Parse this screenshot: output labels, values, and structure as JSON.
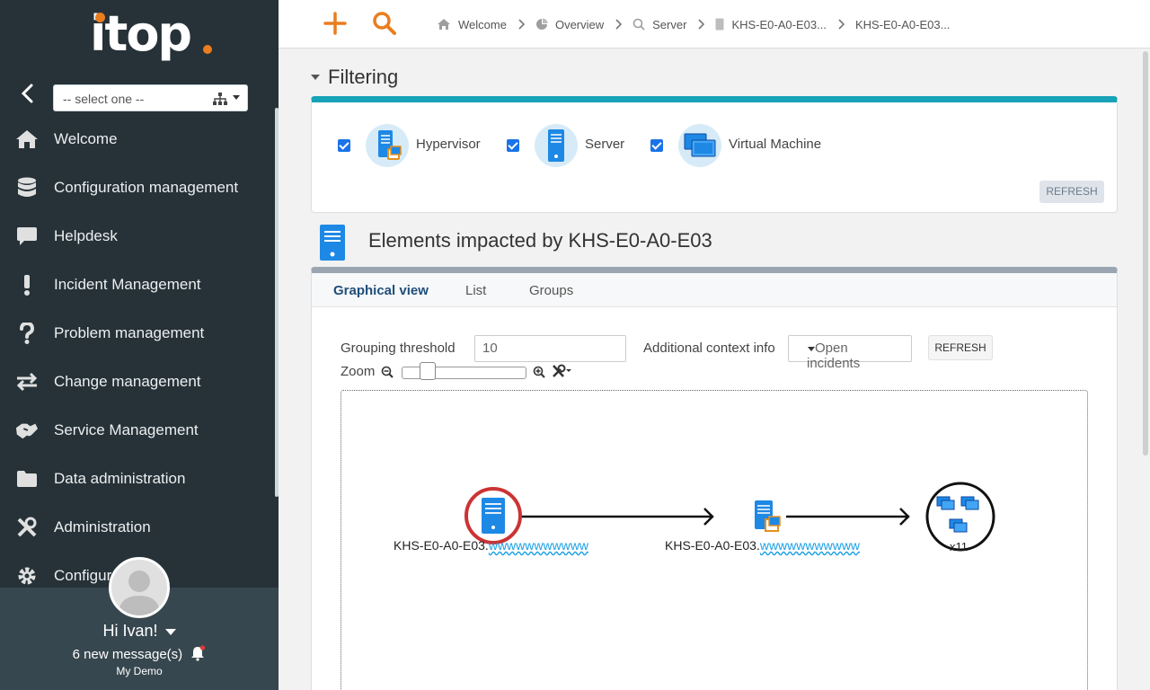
{
  "app": {
    "logo_text": "itop"
  },
  "sidebar": {
    "org_select": {
      "value": "-- select one --"
    },
    "items": [
      {
        "label": "Welcome",
        "icon": "home-icon"
      },
      {
        "label": "Configuration management",
        "icon": "database-icon"
      },
      {
        "label": "Helpdesk",
        "icon": "chat-bubble-icon"
      },
      {
        "label": "Incident Management",
        "icon": "exclamation-icon"
      },
      {
        "label": "Problem management",
        "icon": "question-icon"
      },
      {
        "label": "Change management",
        "icon": "exchange-arrows-icon"
      },
      {
        "label": "Service Management",
        "icon": "handshake-icon"
      },
      {
        "label": "Data administration",
        "icon": "folder-icon"
      },
      {
        "label": "Administration",
        "icon": "tools-icon"
      },
      {
        "label": "Configura",
        "icon": "gear-icon"
      }
    ],
    "user": {
      "greeting": "Hi Ivan!",
      "messages": "6 new message(s)",
      "organization": "My Demo"
    }
  },
  "topbar": {
    "breadcrumb": [
      {
        "label": "Welcome",
        "icon": "home-icon"
      },
      {
        "label": "Overview",
        "icon": "pie-chart-icon"
      },
      {
        "label": "Server",
        "icon": "search-icon"
      },
      {
        "label": "KHS-E0-A0-E03...",
        "icon": "server-icon"
      },
      {
        "label": "KHS-E0-A0-E03...",
        "icon": ""
      }
    ]
  },
  "filtering": {
    "title": "Filtering",
    "classes": [
      {
        "label": "Hypervisor",
        "checked": true
      },
      {
        "label": "Server",
        "checked": true
      },
      {
        "label": "Virtual Machine",
        "checked": true
      }
    ],
    "refresh_label": "REFRESH"
  },
  "impact": {
    "title": "Elements impacted by KHS-E0-A0-E03",
    "tabs": [
      "Graphical view",
      "List",
      "Groups"
    ],
    "active_tab": "Graphical view",
    "grouping_label": "Grouping threshold",
    "grouping_value": "10",
    "context_label": "Additional context info",
    "context_value": "Open incidents",
    "refresh_label": "REFRESH",
    "zoom_label": "Zoom",
    "zoom_level": 0.2,
    "graph": {
      "nodes": [
        {
          "label": "KHS-E0-A0-E03.",
          "type": "server"
        },
        {
          "label": "KHS-E0-A0-E03.",
          "type": "hypervisor"
        },
        {
          "label": "x11",
          "type": "virtual-machine-group"
        }
      ]
    }
  },
  "colors": {
    "sidebar_bg": "#263238",
    "accent_orange": "#ea7d1e",
    "filter_accent": "#17a2b8",
    "icon_blue": "#1e88e5"
  }
}
